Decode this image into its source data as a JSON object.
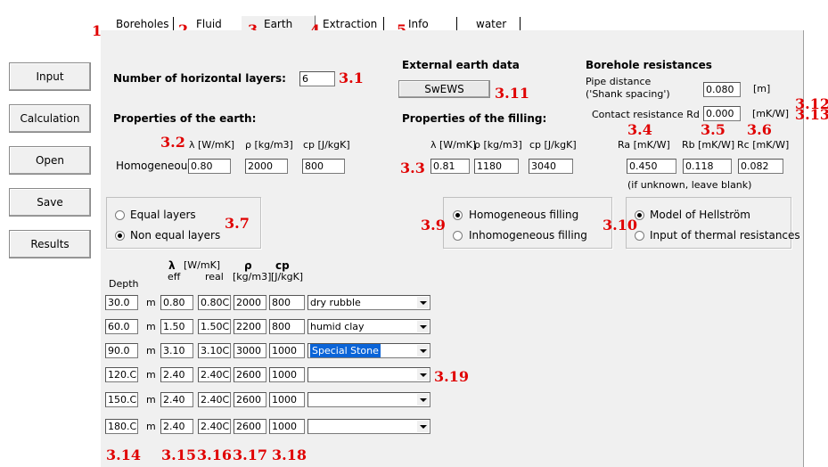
{
  "tabs": [
    "Boreholes",
    "Fluid",
    "Earth",
    "Extraction",
    "Info",
    "water"
  ],
  "side_buttons": [
    "Input",
    "Calculation",
    "Open",
    "Save",
    "Results"
  ],
  "annotations": {
    "a1": "1",
    "a2": "2",
    "a3": "3",
    "a4": "4",
    "a5": "5",
    "a31": "3.1",
    "a311": "3.11",
    "a312": "3.12",
    "a313": "3.13",
    "a32": "3.2",
    "a33": "3.3",
    "a34": "3.4",
    "a35": "3.5",
    "a36": "3.6",
    "a37": "3.7",
    "a39": "3.9",
    "a310": "3.10",
    "a319": "3.19",
    "a314": "3.14",
    "a315": "3.15",
    "a316": "3.16",
    "a317": "3.17",
    "a318": "3.18"
  },
  "earth": {
    "num_layers_label": "Number of horizontal layers:",
    "num_layers_value": "6",
    "properties_heading": "Properties of the earth:",
    "lambda_header": "λ [W/mK]",
    "rho_header": "ρ [kg/m3]",
    "cp_header": "cp [J/kgK]",
    "homogeneous_label": "Homogeneous",
    "lambda_value": "0.80",
    "rho_value": "2000",
    "cp_value": "800"
  },
  "external": {
    "heading": "External earth data",
    "button": "SwEWS"
  },
  "filling": {
    "heading": "Properties of the filling:",
    "lambda_header": "λ [W/mK]",
    "rho_header": "ρ [kg/m3]",
    "cp_header": "cp [J/kgK]",
    "lambda_value": "0.81",
    "rho_value": "1180",
    "cp_value": "3040",
    "homog_option": "Homogeneous filling",
    "inhomog_option": "Inhomogeneous filling"
  },
  "borehole_res": {
    "heading": "Borehole resistances",
    "pipe_distance_label": "Pipe distance",
    "pipe_distance_sub": "('Shank spacing')",
    "pipe_distance_value": "0.080",
    "pipe_distance_unit": "[m]",
    "contact_label": "Contact resistance Rd",
    "contact_value": "0.000",
    "contact_unit": "[mK/W]",
    "ra_header": "Ra [mK/W]",
    "rb_header": "Rb [mK/W]",
    "rc_header": "Rc [mK/W]",
    "ra_value": "0.450",
    "rb_value": "0.118",
    "rc_value": "0.082",
    "hint": "(if unknown, leave blank)",
    "model_option": "Model of Hellström",
    "input_option": "Input of thermal resistances"
  },
  "layers_mode": {
    "equal": "Equal layers",
    "non_equal": "Non equal layers"
  },
  "table_headers": {
    "depth": "Depth",
    "lambda": "λ",
    "lambda_unit": "[W/mK]",
    "eff": "eff",
    "real": "real",
    "rho": "ρ",
    "rho_unit": "[kg/m3]",
    "cp": "cp",
    "cp_unit": "[J/kgK]"
  },
  "unit_m": "m",
  "layers": [
    {
      "depth": "30.0",
      "eff": "0.80",
      "real": "0.80C",
      "rho": "2000",
      "cp": "800",
      "material": "dry rubble"
    },
    {
      "depth": "60.0",
      "eff": "1.50",
      "real": "1.50C",
      "rho": "2200",
      "cp": "800",
      "material": "humid clay"
    },
    {
      "depth": "90.0",
      "eff": "3.10",
      "real": "3.10C",
      "rho": "3000",
      "cp": "1000",
      "material": "Special Stone"
    },
    {
      "depth": "120.C",
      "eff": "2.40",
      "real": "2.40C",
      "rho": "2600",
      "cp": "1000",
      "material": ""
    },
    {
      "depth": "150.C",
      "eff": "2.40",
      "real": "2.40C",
      "rho": "2600",
      "cp": "1000",
      "material": ""
    },
    {
      "depth": "180.C",
      "eff": "2.40",
      "real": "2.40C",
      "rho": "2600",
      "cp": "1000",
      "material": ""
    }
  ]
}
